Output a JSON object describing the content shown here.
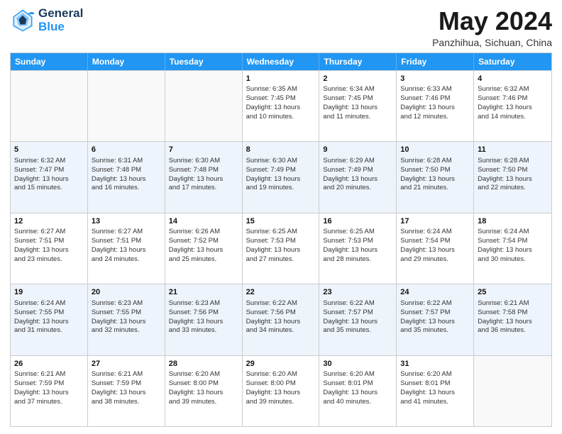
{
  "header": {
    "logo_line1": "General",
    "logo_line2": "Blue",
    "month_title": "May 2024",
    "subtitle": "Panzhihua, Sichuan, China"
  },
  "weekdays": [
    "Sunday",
    "Monday",
    "Tuesday",
    "Wednesday",
    "Thursday",
    "Friday",
    "Saturday"
  ],
  "rows": [
    [
      {
        "day": "",
        "info": ""
      },
      {
        "day": "",
        "info": ""
      },
      {
        "day": "",
        "info": ""
      },
      {
        "day": "1",
        "info": "Sunrise: 6:35 AM\nSunset: 7:45 PM\nDaylight: 13 hours\nand 10 minutes."
      },
      {
        "day": "2",
        "info": "Sunrise: 6:34 AM\nSunset: 7:45 PM\nDaylight: 13 hours\nand 11 minutes."
      },
      {
        "day": "3",
        "info": "Sunrise: 6:33 AM\nSunset: 7:46 PM\nDaylight: 13 hours\nand 12 minutes."
      },
      {
        "day": "4",
        "info": "Sunrise: 6:32 AM\nSunset: 7:46 PM\nDaylight: 13 hours\nand 14 minutes."
      }
    ],
    [
      {
        "day": "5",
        "info": "Sunrise: 6:32 AM\nSunset: 7:47 PM\nDaylight: 13 hours\nand 15 minutes."
      },
      {
        "day": "6",
        "info": "Sunrise: 6:31 AM\nSunset: 7:48 PM\nDaylight: 13 hours\nand 16 minutes."
      },
      {
        "day": "7",
        "info": "Sunrise: 6:30 AM\nSunset: 7:48 PM\nDaylight: 13 hours\nand 17 minutes."
      },
      {
        "day": "8",
        "info": "Sunrise: 6:30 AM\nSunset: 7:49 PM\nDaylight: 13 hours\nand 19 minutes."
      },
      {
        "day": "9",
        "info": "Sunrise: 6:29 AM\nSunset: 7:49 PM\nDaylight: 13 hours\nand 20 minutes."
      },
      {
        "day": "10",
        "info": "Sunrise: 6:28 AM\nSunset: 7:50 PM\nDaylight: 13 hours\nand 21 minutes."
      },
      {
        "day": "11",
        "info": "Sunrise: 6:28 AM\nSunset: 7:50 PM\nDaylight: 13 hours\nand 22 minutes."
      }
    ],
    [
      {
        "day": "12",
        "info": "Sunrise: 6:27 AM\nSunset: 7:51 PM\nDaylight: 13 hours\nand 23 minutes."
      },
      {
        "day": "13",
        "info": "Sunrise: 6:27 AM\nSunset: 7:51 PM\nDaylight: 13 hours\nand 24 minutes."
      },
      {
        "day": "14",
        "info": "Sunrise: 6:26 AM\nSunset: 7:52 PM\nDaylight: 13 hours\nand 25 minutes."
      },
      {
        "day": "15",
        "info": "Sunrise: 6:25 AM\nSunset: 7:53 PM\nDaylight: 13 hours\nand 27 minutes."
      },
      {
        "day": "16",
        "info": "Sunrise: 6:25 AM\nSunset: 7:53 PM\nDaylight: 13 hours\nand 28 minutes."
      },
      {
        "day": "17",
        "info": "Sunrise: 6:24 AM\nSunset: 7:54 PM\nDaylight: 13 hours\nand 29 minutes."
      },
      {
        "day": "18",
        "info": "Sunrise: 6:24 AM\nSunset: 7:54 PM\nDaylight: 13 hours\nand 30 minutes."
      }
    ],
    [
      {
        "day": "19",
        "info": "Sunrise: 6:24 AM\nSunset: 7:55 PM\nDaylight: 13 hours\nand 31 minutes."
      },
      {
        "day": "20",
        "info": "Sunrise: 6:23 AM\nSunset: 7:55 PM\nDaylight: 13 hours\nand 32 minutes."
      },
      {
        "day": "21",
        "info": "Sunrise: 6:23 AM\nSunset: 7:56 PM\nDaylight: 13 hours\nand 33 minutes."
      },
      {
        "day": "22",
        "info": "Sunrise: 6:22 AM\nSunset: 7:56 PM\nDaylight: 13 hours\nand 34 minutes."
      },
      {
        "day": "23",
        "info": "Sunrise: 6:22 AM\nSunset: 7:57 PM\nDaylight: 13 hours\nand 35 minutes."
      },
      {
        "day": "24",
        "info": "Sunrise: 6:22 AM\nSunset: 7:57 PM\nDaylight: 13 hours\nand 35 minutes."
      },
      {
        "day": "25",
        "info": "Sunrise: 6:21 AM\nSunset: 7:58 PM\nDaylight: 13 hours\nand 36 minutes."
      }
    ],
    [
      {
        "day": "26",
        "info": "Sunrise: 6:21 AM\nSunset: 7:59 PM\nDaylight: 13 hours\nand 37 minutes."
      },
      {
        "day": "27",
        "info": "Sunrise: 6:21 AM\nSunset: 7:59 PM\nDaylight: 13 hours\nand 38 minutes."
      },
      {
        "day": "28",
        "info": "Sunrise: 6:20 AM\nSunset: 8:00 PM\nDaylight: 13 hours\nand 39 minutes."
      },
      {
        "day": "29",
        "info": "Sunrise: 6:20 AM\nSunset: 8:00 PM\nDaylight: 13 hours\nand 39 minutes."
      },
      {
        "day": "30",
        "info": "Sunrise: 6:20 AM\nSunset: 8:01 PM\nDaylight: 13 hours\nand 40 minutes."
      },
      {
        "day": "31",
        "info": "Sunrise: 6:20 AM\nSunset: 8:01 PM\nDaylight: 13 hours\nand 41 minutes."
      },
      {
        "day": "",
        "info": ""
      }
    ]
  ]
}
